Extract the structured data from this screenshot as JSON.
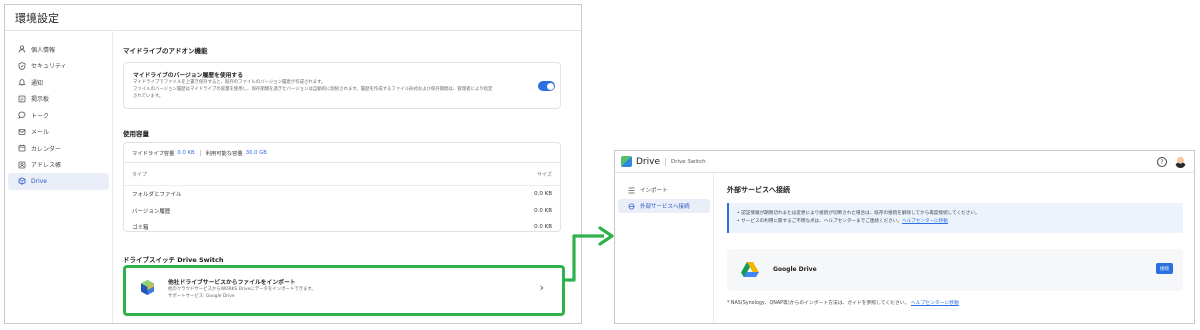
{
  "left": {
    "title": "環境設定",
    "sidebar": [
      {
        "label": "個人情報",
        "icon": "person-icon"
      },
      {
        "label": "セキュリティ",
        "icon": "shield-icon"
      },
      {
        "label": "通知",
        "icon": "bell-icon"
      },
      {
        "label": "掲示板",
        "icon": "board-icon"
      },
      {
        "label": "トーク",
        "icon": "chat-icon"
      },
      {
        "label": "メール",
        "icon": "mail-icon"
      },
      {
        "label": "カレンダー",
        "icon": "calendar-icon"
      },
      {
        "label": "アドレス帳",
        "icon": "contacts-icon"
      },
      {
        "label": "Drive",
        "icon": "drive-icon",
        "active": true
      }
    ],
    "addon": {
      "section_title": "マイドライブのアドオン機能",
      "card_title": "マイドライブのバージョン履歴を使用する",
      "desc1": "マイドライブでファイルを上書き保存すると、既存のファイルのバージョン履歴が作成されます。",
      "desc2": "ファイルのバージョン履歴はマイドライブの容量を使用し、保存期間を過ぎたバージョンは自動的に削除されます。履歴を作成するファイル形式および保存期間は、管理者により指定",
      "desc3": "されています。",
      "toggle_on": true
    },
    "usage": {
      "section_title": "使用容量",
      "capacity_label": "マイドライブ容量",
      "capacity_value": "0.0 KB",
      "available_label": "利用可能な容量",
      "available_value": "30.0 GB",
      "col_type": "タイプ",
      "col_size": "サイズ",
      "rows": [
        {
          "type": "フォルダとファイル",
          "size": "0.0 KB"
        },
        {
          "type": "バージョン履歴",
          "size": "0.0 KB"
        },
        {
          "type": "ゴミ箱",
          "size": "0.0 KB"
        }
      ]
    },
    "switch": {
      "section_title": "ドライブスイッチ Drive Switch",
      "card_title": "他社ドライブサービスからファイルをインポート",
      "card_desc": "他のクラウドサービスからWORKS Driveにデータをインポートできます。",
      "card_support": "サポートサービス: Google Drive",
      "chevron": "›"
    }
  },
  "right": {
    "app_title": "Drive",
    "app_sub": "Drive Switch",
    "help_glyph": "?",
    "sidebar": [
      {
        "label": "インポート",
        "icon": "list-icon"
      },
      {
        "label": "外部サービスへ接続",
        "icon": "link-icon",
        "active": true
      }
    ],
    "page_title": "外部サービスへ接続",
    "info1": "• 認証情報が期限切れまたは変更により接続が切断された場合は、既存の接続を解除してから再度接続してください。",
    "info2": "• サービスの利用に関するご不明な点は、ヘルプセンターまでご連絡ください。",
    "info2_link": "ヘルプセンターに移動",
    "service_name": "Google Drive",
    "connect_label": "接続",
    "footnote": "* NAS(Synology、QNAP等)からのインポート方法は、ガイドを参照してください。",
    "footnote_link": "ヘルプセンターに移動"
  },
  "colors": {
    "accent": "#2b6fe0",
    "highlight": "#2fb24c"
  }
}
